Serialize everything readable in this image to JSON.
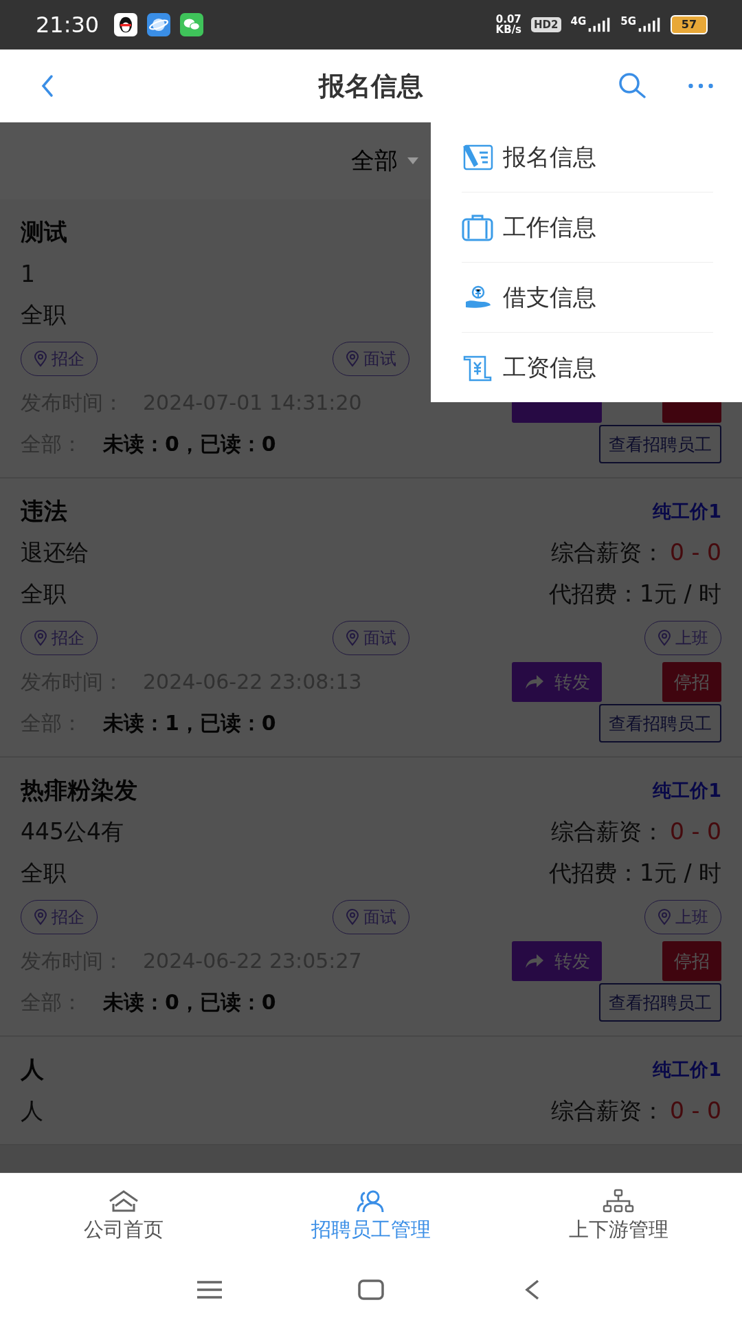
{
  "status_bar": {
    "time": "21:30",
    "net_speed": "0.07",
    "net_unit": "KB/s",
    "hd": "HD2",
    "sim1": "4G",
    "sim2": "5G",
    "battery": "57"
  },
  "header": {
    "title": "报名信息"
  },
  "filter": {
    "label": "全部"
  },
  "cards": [
    {
      "title": "测试",
      "subtitle": "1",
      "type": "全职",
      "tags": [
        "招企",
        "面试"
      ],
      "publish_label": "发布时间：",
      "publish_time": "2024-07-01 14:31:20",
      "read_label": "全部：",
      "read_stats": "未读：0，已读：0",
      "view_button": "查看招聘员工"
    },
    {
      "title": "违法",
      "price_tag": "纯工价1",
      "subtitle": "退还给",
      "salary_label": "综合薪资：",
      "salary_value": "0 - 0",
      "type": "全职",
      "fee": "代招费：1元 / 时",
      "tags": [
        "招企",
        "面试",
        "上班"
      ],
      "publish_label": "发布时间：",
      "publish_time": "2024-06-22 23:08:13",
      "forward": "转发",
      "stop": "停招",
      "read_label": "全部：",
      "read_stats": "未读：1，已读：0",
      "view_button": "查看招聘员工"
    },
    {
      "title": "热痱粉染发",
      "price_tag": "纯工价1",
      "subtitle": "445公4有",
      "salary_label": "综合薪资：",
      "salary_value": "0 - 0",
      "type": "全职",
      "fee": "代招费：1元 / 时",
      "tags": [
        "招企",
        "面试",
        "上班"
      ],
      "publish_label": "发布时间：",
      "publish_time": "2024-06-22 23:05:27",
      "forward": "转发",
      "stop": "停招",
      "read_label": "全部：",
      "read_stats": "未读：0，已读：0",
      "view_button": "查看招聘员工"
    },
    {
      "title": "人",
      "price_tag": "纯工价1",
      "subtitle": "人",
      "salary_label": "综合薪资：",
      "salary_value": "0 - 0"
    }
  ],
  "menu": [
    {
      "label": "报名信息"
    },
    {
      "label": "工作信息"
    },
    {
      "label": "借支信息"
    },
    {
      "label": "工资信息"
    }
  ],
  "bottom_nav": [
    {
      "label": "公司首页",
      "selected": false
    },
    {
      "label": "招聘员工管理",
      "selected": true
    },
    {
      "label": "上下游管理",
      "selected": false
    }
  ]
}
